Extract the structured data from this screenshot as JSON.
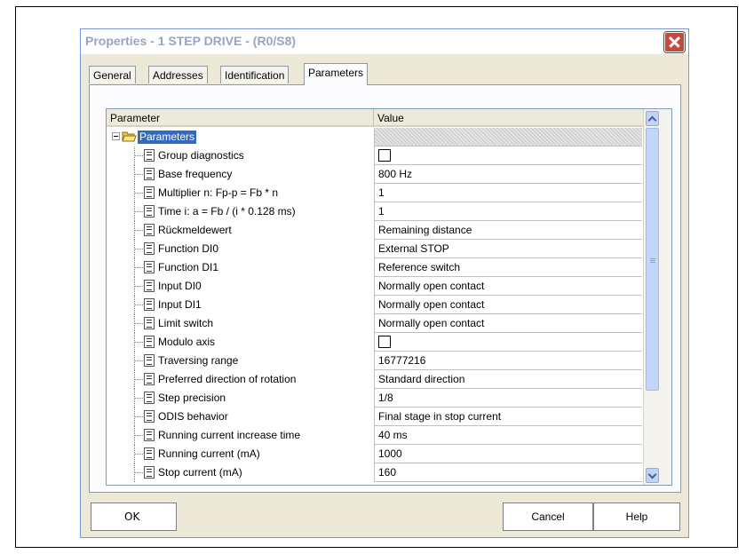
{
  "window": {
    "title": "Properties - 1 STEP DRIVE - (R0/S8)"
  },
  "tabs": [
    "General",
    "Addresses",
    "Identification",
    "Parameters"
  ],
  "table": {
    "columns": [
      "Parameter",
      "Value"
    ],
    "root": {
      "label": "Parameters"
    },
    "rows": [
      {
        "label": "Group diagnostics",
        "value": "",
        "checkbox": true
      },
      {
        "label": "Base frequency",
        "value": "800 Hz"
      },
      {
        "label": "Multiplier n: Fp-p = Fb * n",
        "value": "1"
      },
      {
        "label": "Time i: a = Fb / (i * 0.128 ms)",
        "value": "1"
      },
      {
        "label": "Rückmeldewert",
        "value": "Remaining distance"
      },
      {
        "label": "Function DI0",
        "value": "External STOP"
      },
      {
        "label": "Function DI1",
        "value": "Reference switch"
      },
      {
        "label": "Input DI0",
        "value": "Normally open contact"
      },
      {
        "label": "Input DI1",
        "value": "Normally open contact"
      },
      {
        "label": "Limit switch",
        "value": "Normally open contact"
      },
      {
        "label": "Modulo axis",
        "value": "",
        "checkbox": true
      },
      {
        "label": "Traversing range",
        "value": "16777216"
      },
      {
        "label": "Preferred direction of rotation",
        "value": "Standard direction"
      },
      {
        "label": "Step precision",
        "value": "1/8"
      },
      {
        "label": "ODIS behavior",
        "value": "Final stage in stop current"
      },
      {
        "label": "Running current increase time",
        "value": "40 ms"
      },
      {
        "label": "Running current (mA)",
        "value": "1000"
      },
      {
        "label": "Stop current (mA)",
        "value": "160"
      }
    ]
  },
  "buttons": {
    "ok": "OK",
    "cancel": "Cancel",
    "help": "Help"
  }
}
